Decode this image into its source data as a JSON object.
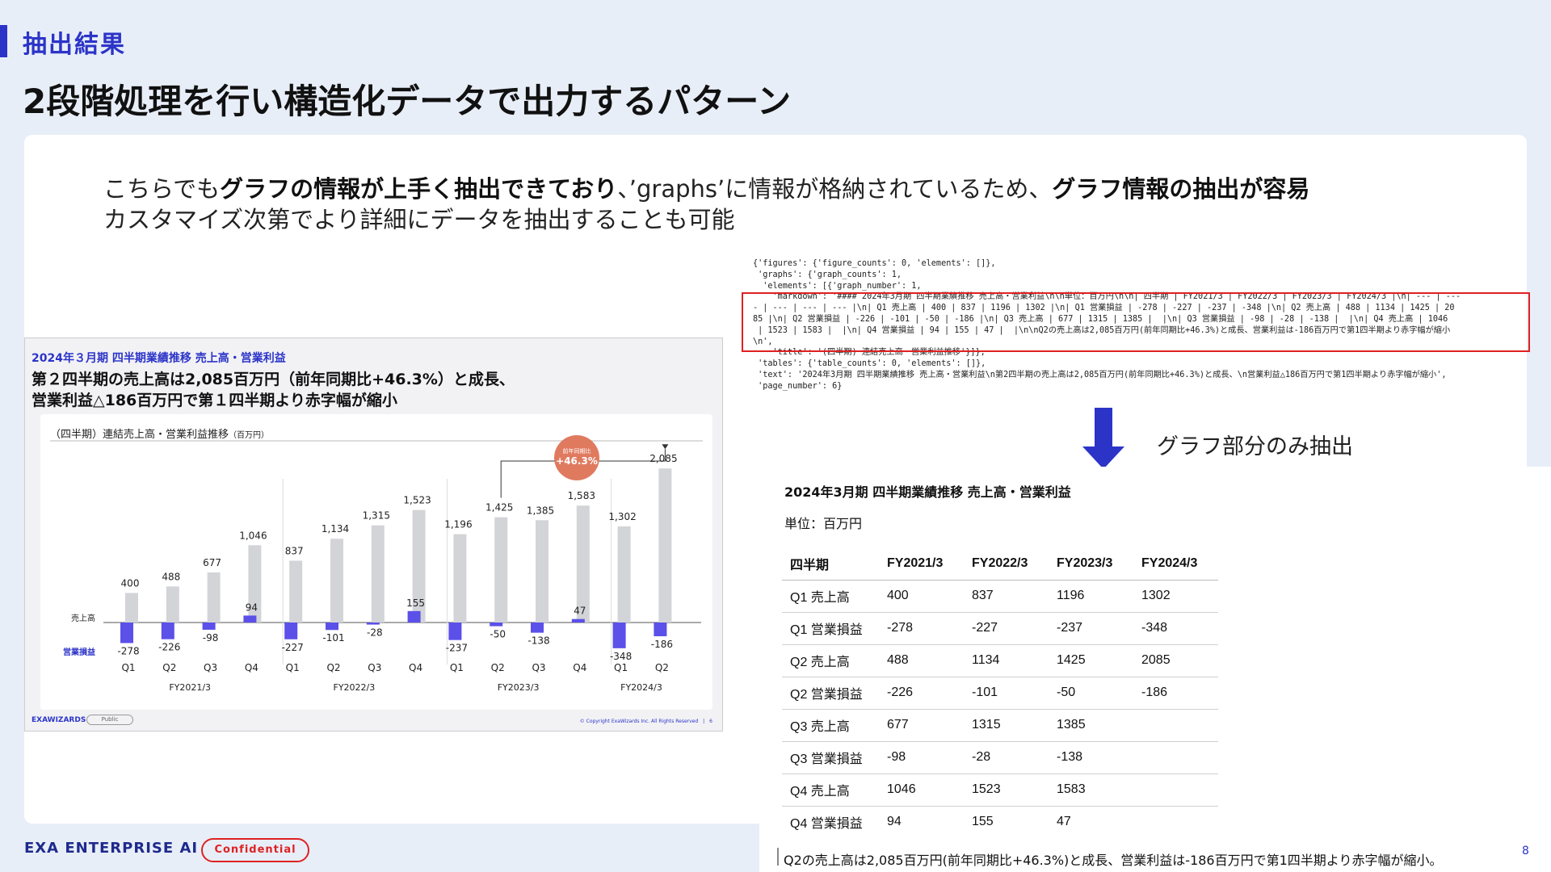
{
  "header": {
    "section_label": "抽出結果",
    "title": "2段階処理を行い構造化データで出力するパターン"
  },
  "lead": {
    "l1_a": "こちらでも",
    "l1_b": "グラフの情報が上手く抽出できており",
    "l1_c": "、’graphs’に情報が格納されているため、",
    "l1_d": "グラフ情報の抽出が容易",
    "l2": "カスタマイズ次第でより詳細にデータを抽出することも可能"
  },
  "slide": {
    "kicker": "2024年３月期 四半期業績推移 売上高・営業利益",
    "headline_1": "第２四半期の売上高は2,085百万円（前年同期比+46.3%）と成長、",
    "headline_2": "営業利益△186百万円で第１四半期より赤字幅が縮小",
    "chart_title": "（四半期）連結売上高・営業利益推移",
    "chart_unit": "（百万円）",
    "badge_top": "前年同期比",
    "badge_value": "+46.3%",
    "footer_logo": "EXAWIZARDS",
    "footer_tag": "Public",
    "footer_copy": "© Copyright ExaWizards Inc. All Rights Reserved　|　6"
  },
  "chart_data": {
    "type": "bar",
    "title": "（四半期）連結売上高・営業利益推移",
    "unit": "（百万円）",
    "categories": [
      "Q1",
      "Q2",
      "Q3",
      "Q4",
      "Q1",
      "Q2",
      "Q3",
      "Q4",
      "Q1",
      "Q2",
      "Q3",
      "Q4",
      "Q1",
      "Q2"
    ],
    "groups": [
      "FY2021/3",
      "FY2022/3",
      "FY2023/3",
      "FY2024/3"
    ],
    "group_sizes": [
      4,
      4,
      4,
      2
    ],
    "series": [
      {
        "name": "売上高",
        "values": [
          400,
          488,
          677,
          1046,
          837,
          1134,
          1315,
          1523,
          1196,
          1425,
          1385,
          1583,
          1302,
          2085
        ],
        "labels": [
          "400",
          "488",
          "677",
          "1,046",
          "837",
          "1,134",
          "1,315",
          "1,523",
          "1,196",
          "1,425",
          "1,385",
          "1,583",
          "1,302",
          "2,085"
        ]
      },
      {
        "name": "営業損益",
        "values": [
          -278,
          -226,
          -98,
          94,
          -227,
          -101,
          -28,
          155,
          -237,
          -50,
          -138,
          47,
          -348,
          -186
        ],
        "labels": [
          "-278",
          "-226",
          "-98",
          "94",
          "-227",
          "-101",
          "-28",
          "155",
          "-237",
          "-50",
          "-138",
          "47",
          "-348",
          "-186"
        ]
      }
    ],
    "colors": {
      "sales": "#d3d4d8",
      "profit": "#5b50e8",
      "badge": "#e07a5f"
    }
  },
  "code": {
    "lines": [
      "{'figures': {'figure_counts': 0, 'elements': []},",
      " 'graphs': {'graph_counts': 1,",
      "  'elements': [{'graph_number': 1,",
      "    'markdown': '#### 2024年3月期 四半期業績推移 売上高・営業利益\\n\\n単位：百万円\\n\\n| 四半期 | FY2021/3 | FY2022/3 | FY2023/3 | FY2024/3 |\\n| --- | ---",
      "- | --- | --- | --- |\\n| Q1 売上高 | 400 | 837 | 1196 | 1302 |\\n| Q1 営業損益 | -278 | -227 | -237 | -348 |\\n| Q2 売上高 | 488 | 1134 | 1425 | 20",
      "85 |\\n| Q2 営業損益 | -226 | -101 | -50 | -186 |\\n| Q3 売上高 | 677 | 1315 | 1385 |  |\\n| Q3 営業損益 | -98 | -28 | -138 |  |\\n| Q4 売上高 | 1046",
      " | 1523 | 1583 |  |\\n| Q4 営業損益 | 94 | 155 | 47 |  |\\n\\nQ2の売上高は2,085百万円(前年同期比+46.3%)と成長、営業利益は-186百万円で第1四半期より赤字幅が縮小",
      "\\n',",
      "    'title': '(四半期) 連結売上高・営業利益推移'}]},",
      " 'tables': {'table_counts': 0, 'elements': []},",
      " 'text': '2024年3月期 四半期業績推移 売上高・営業利益\\n第2四半期の売上高は2,085百万円(前年同期比+46.3%)と成長、\\n営業利益△186百万円で第1四半期より赤字幅が縮小',",
      " 'page_number': 6}"
    ]
  },
  "arrow_label": "グラフ部分のみ抽出",
  "result": {
    "title": "2024年3月期 四半期業績推移 売上高・営業利益",
    "unit": "単位：百万円",
    "headers": [
      "四半期",
      "FY2021/3",
      "FY2022/3",
      "FY2023/3",
      "FY2024/3"
    ],
    "rows": [
      [
        "Q1 売上高",
        "400",
        "837",
        "1196",
        "1302"
      ],
      [
        "Q1 営業損益",
        "-278",
        "-227",
        "-237",
        "-348"
      ],
      [
        "Q2 売上高",
        "488",
        "1134",
        "1425",
        "2085"
      ],
      [
        "Q2 営業損益",
        "-226",
        "-101",
        "-50",
        "-186"
      ],
      [
        "Q3 売上高",
        "677",
        "1315",
        "1385",
        ""
      ],
      [
        "Q3 営業損益",
        "-98",
        "-28",
        "-138",
        ""
      ],
      [
        "Q4 売上高",
        "1046",
        "1523",
        "1583",
        ""
      ],
      [
        "Q4 営業損益",
        "94",
        "155",
        "47",
        ""
      ]
    ],
    "note": "Q2の売上高は2,085百万円(前年同期比+46.3%)と成長、営業利益は-186百万円で第1四半期より赤字幅が縮小。"
  },
  "footer": {
    "brand": "EXA ENTERPRISE AI",
    "confidential": "Confidential",
    "page": "8"
  }
}
